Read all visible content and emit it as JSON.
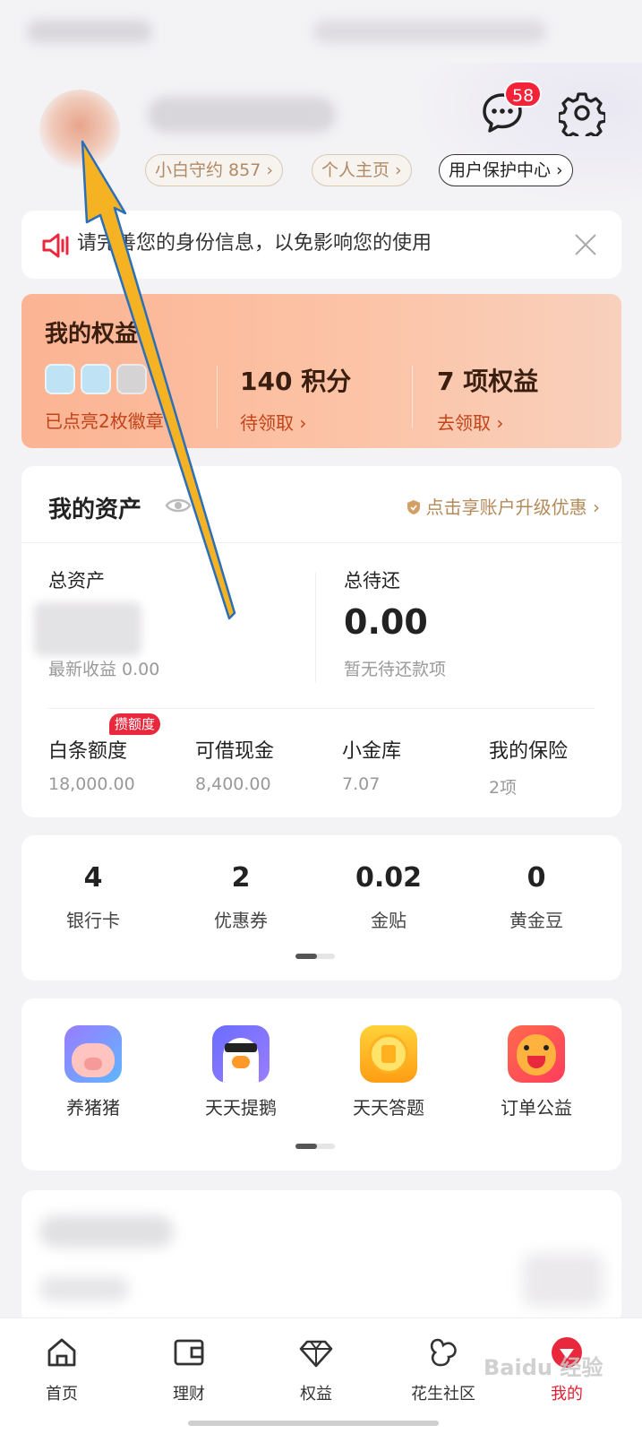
{
  "header": {
    "message_badge": "58",
    "pills": [
      "小白守约 857 ›",
      "个人主页 ›",
      "用户保护中心 ›"
    ]
  },
  "notice": {
    "text": "请完善您的身份信息，以免影响您的使用"
  },
  "rights": {
    "title": "我的权益",
    "badges_text": "已点亮2枚徽章 ›",
    "points_value": "140 积分",
    "points_sub": "待领取 ›",
    "benefits_value": "7 项权益",
    "benefits_sub": "去领取 ›"
  },
  "assets": {
    "title": "我的资产",
    "upgrade": "点击享账户升级优惠 ›",
    "total_label": "总资产",
    "total_note": "最新收益 0.00",
    "repay_label": "总待还",
    "repay_value": "0.00",
    "repay_note": "暂无待还款项",
    "boost_tag": "攒额度",
    "items": [
      {
        "label": "白条额度",
        "value": "18,000.00"
      },
      {
        "label": "可借现金",
        "value": "8,400.00"
      },
      {
        "label": "小金库",
        "value": "7.07"
      },
      {
        "label": "我的保险",
        "value": "2项"
      }
    ]
  },
  "stats": [
    {
      "num": "4",
      "label": "银行卡"
    },
    {
      "num": "2",
      "label": "优惠券"
    },
    {
      "num": "0.02",
      "label": "金贴"
    },
    {
      "num": "0",
      "label": "黄金豆"
    }
  ],
  "apps": [
    {
      "label": "养猪猪",
      "icon": "pig-icon"
    },
    {
      "label": "天天提鹅",
      "icon": "goose-icon"
    },
    {
      "label": "天天答题",
      "icon": "coin-icon"
    },
    {
      "label": "订单公益",
      "icon": "dog-icon"
    }
  ],
  "tabs": [
    {
      "label": "首页",
      "icon": "home-icon"
    },
    {
      "label": "理财",
      "icon": "wallet-icon"
    },
    {
      "label": "权益",
      "icon": "diamond-icon"
    },
    {
      "label": "花生社区",
      "icon": "peanut-icon"
    },
    {
      "label": "我的",
      "icon": "profile-icon",
      "active": true
    }
  ],
  "watermark": "Baidu 经验",
  "colors": {
    "accent": "#e02232",
    "badge": "#f3243a",
    "rights_bg": "#fbb493"
  }
}
